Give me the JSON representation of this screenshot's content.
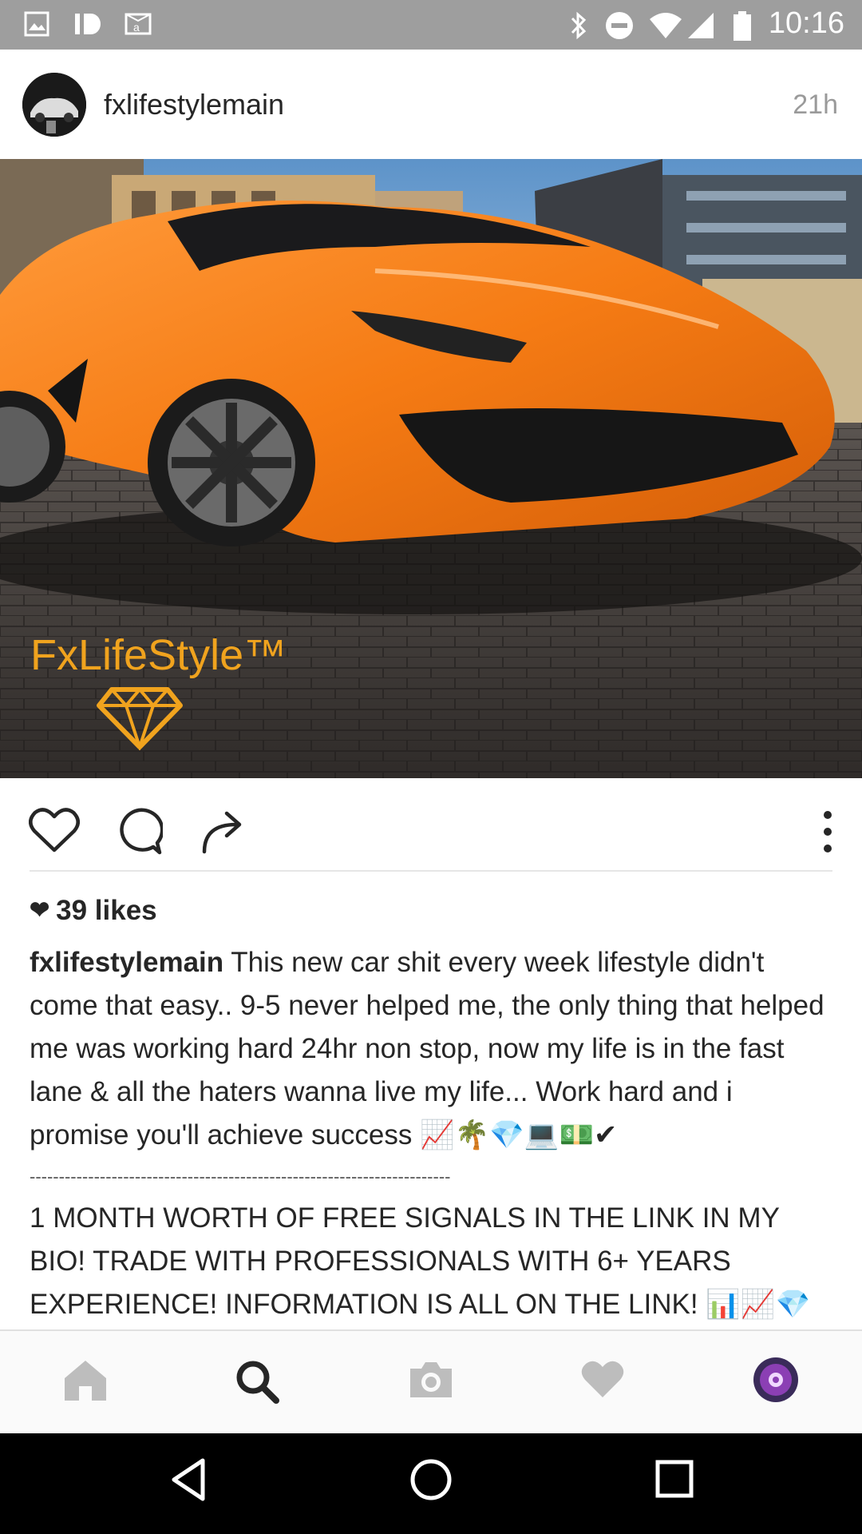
{
  "status_bar": {
    "time": "10:16",
    "icons": [
      "image-icon",
      "id-icon",
      "amazon-icon",
      "bluetooth-icon",
      "do-not-disturb-icon",
      "wifi-icon",
      "signal-icon",
      "battery-icon"
    ]
  },
  "post": {
    "username": "fxlifestylemain",
    "timestamp": "21h",
    "watermark": "FxLifeStyle™",
    "likes": "39 likes",
    "caption": {
      "username": "fxlifestylemain",
      "text": "This new car shit every week lifestyle didn't come that easy.. 9-5 never helped me, the only thing that helped me was working hard 24hr non stop, now my life is in the fast lane & all the haters wanna live my life... Work hard and i promise you'll achieve success",
      "emoji_line1": "📈🌴💎💻💵✔",
      "separator": "------------------------------------------------------------------------",
      "promo_text": "1 MONTH WORTH OF FREE SIGNALS IN THE LINK IN MY BIO! TRADE WITH PROFESSIONALS WITH 6+ YEARS EXPERIENCE! INFORMATION IS ALL ON THE LINK!",
      "emoji_line2": "📊📈💎💻🌴💷🚀💵"
    },
    "actions": [
      "heart-icon",
      "comment-icon",
      "share-icon",
      "more-icon"
    ]
  },
  "bottom_nav": [
    "home-icon",
    "search-icon",
    "camera-icon",
    "activity-heart-icon",
    "profile-icon"
  ],
  "android_nav": [
    "back-icon",
    "home-circle-icon",
    "recents-icon"
  ],
  "colors": {
    "status_bar": "#9e9e9e",
    "car": "#f57b14",
    "watermark": "#f0a31e",
    "text": "#262626",
    "muted": "#9a9a9a"
  }
}
